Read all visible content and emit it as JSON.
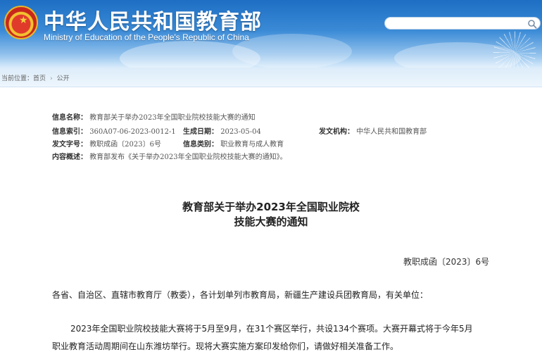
{
  "header": {
    "title": "中华人民共和国教育部",
    "subtitle": "Ministry of Education of the People's Republic of China",
    "search_placeholder": ""
  },
  "breadcrumb": {
    "label": "当前位置：",
    "items": [
      "首页",
      "公开"
    ]
  },
  "meta": {
    "name_label": "信息名称：",
    "name_value": "教育部关于举办2023年全国职业院校技能大赛的通知",
    "index_label": "信息索引：",
    "index_value": "360A07-06-2023-0012-1",
    "date_label": "生成日期：",
    "date_value": "2023-05-04",
    "issuer_label": "发文机构：",
    "issuer_value": "中华人民共和国教育部",
    "docno_label": "发文字号：",
    "docno_value": "教职成函〔2023〕6号",
    "category_label": "信息类别：",
    "category_value": "职业教育与成人教育",
    "summary_label": "内容概述：",
    "summary_value": "教育部发布《关于举办2023年全国职业院校技能大赛的通知》。"
  },
  "article": {
    "title_line1": "教育部关于举办2023年全国职业院校",
    "title_line2": "技能大赛的通知",
    "doc_number": "教职成函〔2023〕6号",
    "salutation": "各省、自治区、直辖市教育厅（教委），各计划单列市教育局，新疆生产建设兵团教育局，有关单位：",
    "para1_line1": "2023年全国职业院校技能大赛将于5月至9月，在31个赛区举行，共设134个赛项。大赛开幕式将于今年5月",
    "para1_line2": "职业教育活动周期间在山东潍坊举行。现将大赛实施方案印发给你们，请做好相关准备工作。"
  },
  "colors": {
    "header_blue": "#1e6fc4",
    "crumb_bg": "#dcecf9"
  },
  "icons": {
    "search": "search-icon",
    "emblem": "national-emblem-icon"
  }
}
